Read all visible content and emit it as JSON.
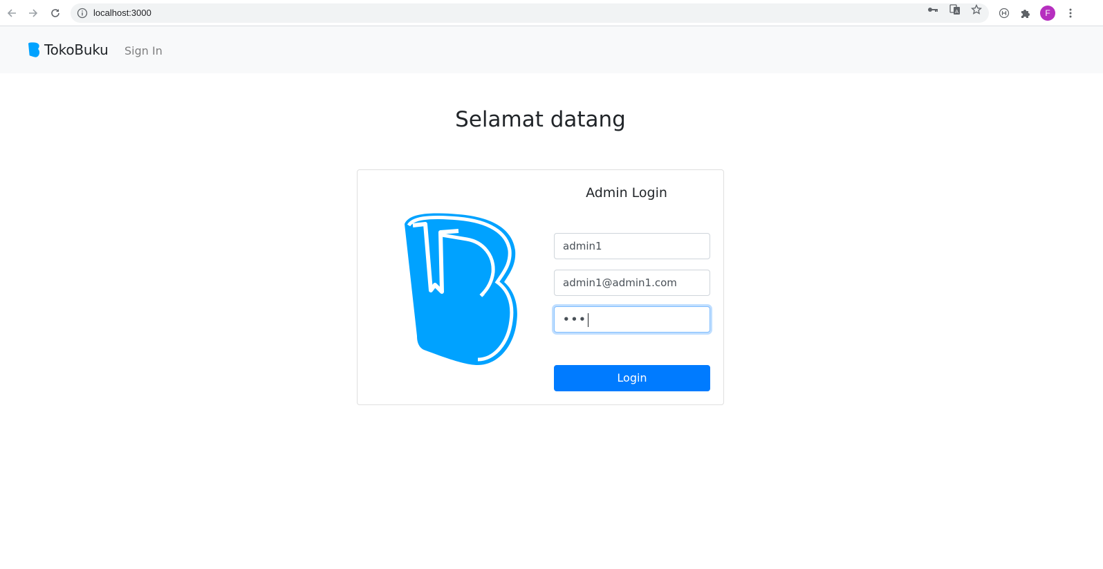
{
  "browser": {
    "url": "localhost:3000",
    "profile_initial": "F",
    "colors": {
      "omnibox": "#f1f3f4",
      "avatar": "#b62fbf"
    },
    "icons": [
      "back-arrow-icon",
      "forward-arrow-icon",
      "reload-icon",
      "info-icon",
      "key-icon",
      "translate-icon",
      "star-icon",
      "extension-h-icon",
      "puzzle-icon",
      "more-vert-icon"
    ]
  },
  "navbar": {
    "brand": "TokoBuku",
    "links": [
      {
        "label": "Sign In"
      }
    ],
    "colors": {
      "background": "#f8f9fa"
    }
  },
  "page": {
    "heading": "Selamat datang"
  },
  "login_card": {
    "title": "Admin Login",
    "logo_icon": "tokobuku-logo-icon",
    "username_value": "admin1",
    "email_value": "admin1@admin1.com",
    "password_value": "•••",
    "login_label": "Login",
    "colors": {
      "logo": "#00a2ff",
      "button": "#007bff"
    }
  }
}
